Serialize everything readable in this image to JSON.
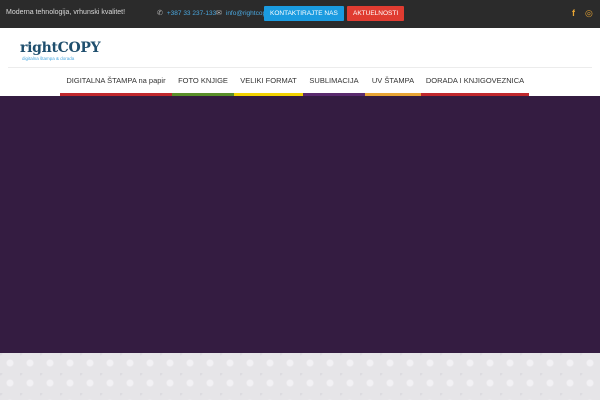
{
  "topbar": {
    "tagline": "Moderna tehnologija, vrhunski kvalitet!",
    "phone": "+387 33 237-133",
    "phone_icon": "phone-icon",
    "email": "info@rightcopy.ba",
    "email_icon": "envelope-icon",
    "contact_button": "KONTAKTIRAJTE NAS",
    "news_button": "AKTUELNOSTI",
    "social": [
      {
        "name": "facebook-icon",
        "glyph": "f"
      },
      {
        "name": "instagram-icon",
        "glyph": "◎"
      }
    ],
    "colors": {
      "bg": "#2b2b2b",
      "contact_btn": "#1a9be0",
      "news_btn": "#e03c31",
      "social": "#e8a534"
    }
  },
  "header": {
    "logo_text": "rightCOPY",
    "logo_sub": "digitalna štampa & dorada",
    "nav": [
      {
        "label": "DIGITALNA ŠTAMPA na papir",
        "color": "#c0282d"
      },
      {
        "label": "FOTO KNJIGE",
        "color": "#5a8f2a"
      },
      {
        "label": "VELIKI FORMAT",
        "color": "#f2d200"
      },
      {
        "label": "SUBLIMACIJA",
        "color": "#5a2a6e"
      },
      {
        "label": "UV ŠTAMPA",
        "color": "#e8a534"
      },
      {
        "label": "DORADA I KNJIGOVEZNICA",
        "color": "#c0282d"
      }
    ]
  },
  "hero": {
    "bg": "#341c41"
  }
}
